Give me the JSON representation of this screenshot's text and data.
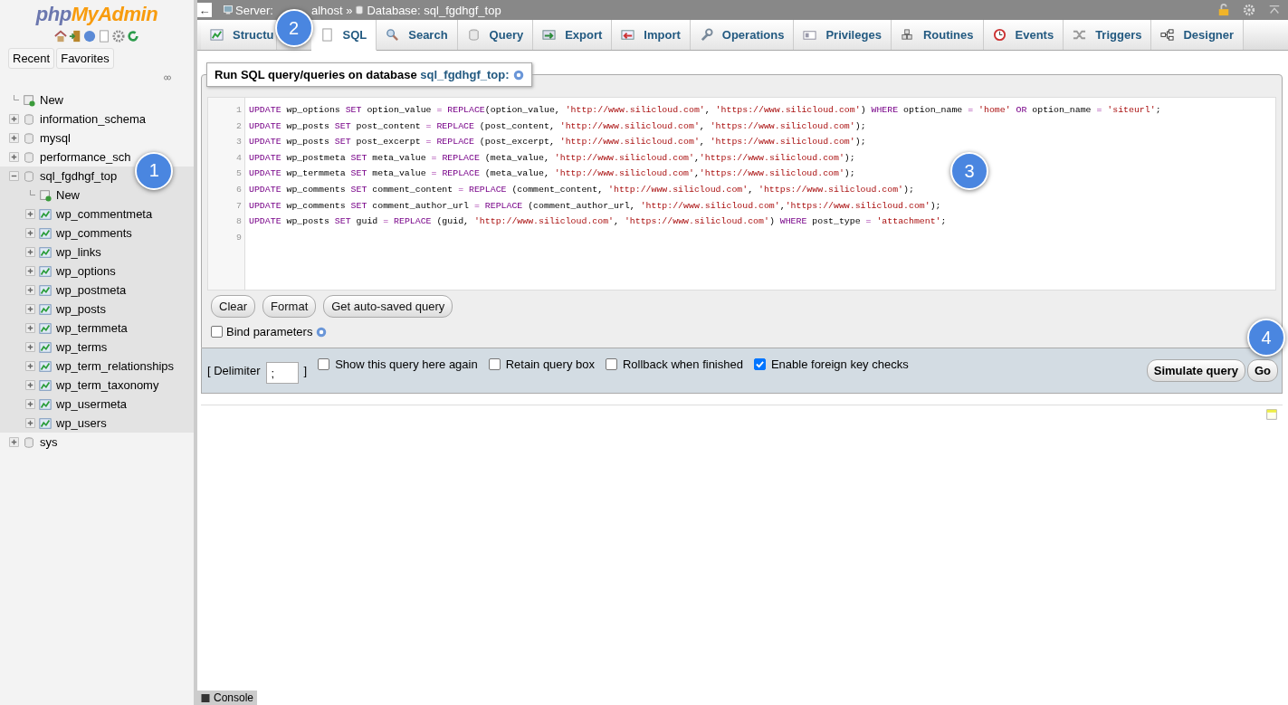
{
  "sidebar": {
    "logo_parts": [
      "php",
      "MyAdmin"
    ],
    "quick_tabs": [
      "Recent",
      "Favorites"
    ],
    "tree": [
      {
        "kind": "new",
        "label": "New"
      },
      {
        "kind": "db",
        "label": "information_schema",
        "expanded": false
      },
      {
        "kind": "db",
        "label": "mysql",
        "expanded": false
      },
      {
        "kind": "db",
        "label": "performance_sch",
        "expanded": false
      },
      {
        "kind": "db",
        "label": "sql_fgdhgf_top",
        "expanded": true,
        "selected": true,
        "callout": "1",
        "children": [
          {
            "kind": "new",
            "label": "New"
          },
          {
            "kind": "table",
            "label": "wp_commentmeta",
            "expanded": false
          },
          {
            "kind": "table",
            "label": "wp_comments",
            "expanded": false
          },
          {
            "kind": "table",
            "label": "wp_links",
            "expanded": false
          },
          {
            "kind": "table",
            "label": "wp_options",
            "expanded": false
          },
          {
            "kind": "table",
            "label": "wp_postmeta",
            "expanded": false
          },
          {
            "kind": "table",
            "label": "wp_posts",
            "expanded": false
          },
          {
            "kind": "table",
            "label": "wp_termmeta",
            "expanded": false
          },
          {
            "kind": "table",
            "label": "wp_terms",
            "expanded": false
          },
          {
            "kind": "table",
            "label": "wp_term_relationships",
            "expanded": false
          },
          {
            "kind": "table",
            "label": "wp_term_taxonomy",
            "expanded": false
          },
          {
            "kind": "table",
            "label": "wp_usermeta",
            "expanded": false
          },
          {
            "kind": "table",
            "label": "wp_users",
            "expanded": false
          }
        ]
      },
      {
        "kind": "db",
        "label": "sys",
        "expanded": false
      }
    ]
  },
  "back_button": "←",
  "breadcrumb": {
    "server_parts": [
      "Server:",
      "alhost »"
    ],
    "database": "Database: sql_fgdhgf_top"
  },
  "tabs": [
    {
      "kind": "structure",
      "label": "Structu",
      "selected": false,
      "callout": "2"
    },
    {
      "kind": "sql",
      "label": "SQL",
      "selected": true
    },
    {
      "kind": "search",
      "label": "Search",
      "selected": false
    },
    {
      "kind": "query",
      "label": "Query",
      "selected": false
    },
    {
      "kind": "export",
      "label": "Export",
      "selected": false
    },
    {
      "kind": "import",
      "label": "Import",
      "selected": false
    },
    {
      "kind": "operations",
      "label": "Operations",
      "selected": false
    },
    {
      "kind": "privileges",
      "label": "Privileges",
      "selected": false
    },
    {
      "kind": "routines",
      "label": "Routines",
      "selected": false
    },
    {
      "kind": "events",
      "label": "Events",
      "selected": false
    },
    {
      "kind": "triggers",
      "label": "Triggers",
      "selected": false
    },
    {
      "kind": "designer",
      "label": "Designer",
      "selected": false
    }
  ],
  "query_box": {
    "legend": "Run SQL query/queries on database ",
    "legend_db": "sql_fgdhgf_top:",
    "callout": "3",
    "lines": [
      [
        {
          "kind": "keyword",
          "text": "UPDATE"
        },
        {
          "kind": "plain",
          "text": " wp_options "
        },
        {
          "kind": "keyword",
          "text": "SET"
        },
        {
          "kind": "plain",
          "text": " option_value "
        },
        {
          "kind": "op",
          "text": "= "
        },
        {
          "kind": "keyword",
          "text": "REPLACE"
        },
        {
          "kind": "plain",
          "text": "(option_value, "
        },
        {
          "kind": "string",
          "text": "'http://www.silicloud.com'"
        },
        {
          "kind": "plain",
          "text": ", "
        },
        {
          "kind": "string",
          "text": "'https://www.silicloud.com'"
        },
        {
          "kind": "plain",
          "text": ") "
        },
        {
          "kind": "keyword",
          "text": "WHERE"
        },
        {
          "kind": "plain",
          "text": " option_name "
        },
        {
          "kind": "op",
          "text": "= "
        },
        {
          "kind": "string",
          "text": "'home' "
        },
        {
          "kind": "keyword",
          "text": "OR"
        },
        {
          "kind": "plain",
          "text": " option_name "
        },
        {
          "kind": "op",
          "text": "= "
        },
        {
          "kind": "string",
          "text": "'siteurl'"
        },
        {
          "kind": "plain",
          "text": ";"
        }
      ],
      [
        {
          "kind": "keyword",
          "text": "UPDATE"
        },
        {
          "kind": "plain",
          "text": " wp_posts "
        },
        {
          "kind": "keyword",
          "text": "SET"
        },
        {
          "kind": "plain",
          "text": " post_content "
        },
        {
          "kind": "op",
          "text": "= "
        },
        {
          "kind": "keyword",
          "text": "REPLACE"
        },
        {
          "kind": "plain",
          "text": " (post_content, "
        },
        {
          "kind": "string",
          "text": "'http://www.silicloud.com'"
        },
        {
          "kind": "plain",
          "text": ", "
        },
        {
          "kind": "string",
          "text": "'https://www.silicloud.com'"
        },
        {
          "kind": "plain",
          "text": ");"
        }
      ],
      [
        {
          "kind": "keyword",
          "text": "UPDATE"
        },
        {
          "kind": "plain",
          "text": " wp_posts "
        },
        {
          "kind": "keyword",
          "text": "SET"
        },
        {
          "kind": "plain",
          "text": " post_excerpt "
        },
        {
          "kind": "op",
          "text": "= "
        },
        {
          "kind": "keyword",
          "text": "REPLACE"
        },
        {
          "kind": "plain",
          "text": " (post_excerpt, "
        },
        {
          "kind": "string",
          "text": "'http://www.silicloud.com'"
        },
        {
          "kind": "plain",
          "text": ", "
        },
        {
          "kind": "string",
          "text": "'https://www.silicloud.com'"
        },
        {
          "kind": "plain",
          "text": ");"
        }
      ],
      [
        {
          "kind": "keyword",
          "text": "UPDATE"
        },
        {
          "kind": "plain",
          "text": " wp_postmeta "
        },
        {
          "kind": "keyword",
          "text": "SET"
        },
        {
          "kind": "plain",
          "text": " meta_value "
        },
        {
          "kind": "op",
          "text": "= "
        },
        {
          "kind": "keyword",
          "text": "REPLACE"
        },
        {
          "kind": "plain",
          "text": " (meta_value, "
        },
        {
          "kind": "string",
          "text": "'http://www.silicloud.com'"
        },
        {
          "kind": "plain",
          "text": ","
        },
        {
          "kind": "string",
          "text": "'https://www.silicloud.com'"
        },
        {
          "kind": "plain",
          "text": ");"
        }
      ],
      [
        {
          "kind": "keyword",
          "text": "UPDATE"
        },
        {
          "kind": "plain",
          "text": " wp_termmeta "
        },
        {
          "kind": "keyword",
          "text": "SET"
        },
        {
          "kind": "plain",
          "text": " meta_value "
        },
        {
          "kind": "op",
          "text": "= "
        },
        {
          "kind": "keyword",
          "text": "REPLACE"
        },
        {
          "kind": "plain",
          "text": " (meta_value, "
        },
        {
          "kind": "string",
          "text": "'http://www.silicloud.com'"
        },
        {
          "kind": "plain",
          "text": ","
        },
        {
          "kind": "string",
          "text": "'https://www.silicloud.com'"
        },
        {
          "kind": "plain",
          "text": ");"
        }
      ],
      [
        {
          "kind": "keyword",
          "text": "UPDATE"
        },
        {
          "kind": "plain",
          "text": " wp_comments "
        },
        {
          "kind": "keyword",
          "text": "SET"
        },
        {
          "kind": "plain",
          "text": " comment_content "
        },
        {
          "kind": "op",
          "text": "= "
        },
        {
          "kind": "keyword",
          "text": "REPLACE"
        },
        {
          "kind": "plain",
          "text": " (comment_content, "
        },
        {
          "kind": "string",
          "text": "'http://www.silicloud.com'"
        },
        {
          "kind": "plain",
          "text": ", "
        },
        {
          "kind": "string",
          "text": "'https://www.silicloud.com'"
        },
        {
          "kind": "plain",
          "text": ");"
        }
      ],
      [
        {
          "kind": "keyword",
          "text": "UPDATE"
        },
        {
          "kind": "plain",
          "text": " wp_comments "
        },
        {
          "kind": "keyword",
          "text": "SET"
        },
        {
          "kind": "plain",
          "text": " comment_author_url "
        },
        {
          "kind": "op",
          "text": "= "
        },
        {
          "kind": "keyword",
          "text": "REPLACE"
        },
        {
          "kind": "plain",
          "text": " (comment_author_url, "
        },
        {
          "kind": "string",
          "text": "'http://www.silicloud.com'"
        },
        {
          "kind": "plain",
          "text": ","
        },
        {
          "kind": "string",
          "text": "'https://www.silicloud.com'"
        },
        {
          "kind": "plain",
          "text": ");"
        }
      ],
      [
        {
          "kind": "keyword",
          "text": "UPDATE"
        },
        {
          "kind": "plain",
          "text": " wp_posts "
        },
        {
          "kind": "keyword",
          "text": "SET"
        },
        {
          "kind": "plain",
          "text": " guid "
        },
        {
          "kind": "op",
          "text": "= "
        },
        {
          "kind": "keyword",
          "text": "REPLACE"
        },
        {
          "kind": "plain",
          "text": " (guid, "
        },
        {
          "kind": "string",
          "text": "'http://www.silicloud.com'"
        },
        {
          "kind": "plain",
          "text": ", "
        },
        {
          "kind": "string",
          "text": "'https://www.silicloud.com'"
        },
        {
          "kind": "plain",
          "text": ") "
        },
        {
          "kind": "keyword",
          "text": "WHERE"
        },
        {
          "kind": "plain",
          "text": " post_type "
        },
        {
          "kind": "op",
          "text": "= "
        },
        {
          "kind": "string",
          "text": "'attachment'"
        },
        {
          "kind": "plain",
          "text": ";"
        }
      ]
    ],
    "line_numbers": [
      "1",
      "2",
      "3",
      "4",
      "5",
      "6",
      "7",
      "8",
      "9"
    ],
    "buttons": [
      "Clear",
      "Format",
      "Get auto-saved query"
    ],
    "bind_parameters": {
      "label": "Bind parameters",
      "checked": false
    }
  },
  "footer": {
    "delimiter_open": "[ Delimiter",
    "delimiter_value": ";",
    "delimiter_close": "]",
    "options": [
      {
        "label": "Show this query here again",
        "checked": false
      },
      {
        "label": "Retain query box",
        "checked": false
      },
      {
        "label": "Rollback when finished",
        "checked": false
      },
      {
        "label": "Enable foreign key checks",
        "checked": true
      }
    ],
    "simulate": "Simulate query",
    "go": "Go",
    "go_callout": "4"
  },
  "console": "Console"
}
